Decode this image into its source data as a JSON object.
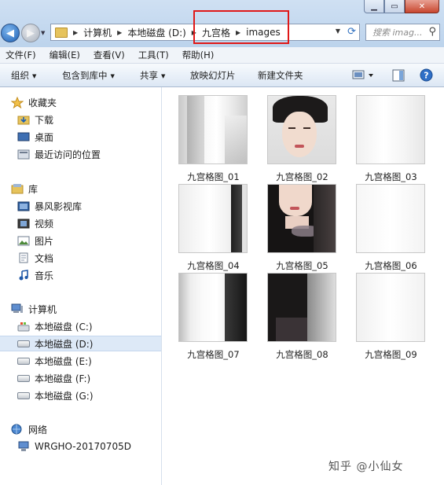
{
  "address": {
    "crumbs": [
      "计算机",
      "本地磁盘 (D:)",
      "九宫格",
      "images"
    ]
  },
  "search": {
    "placeholder": "搜索 imag..."
  },
  "menu": [
    "文件(F)",
    "编辑(E)",
    "查看(V)",
    "工具(T)",
    "帮助(H)"
  ],
  "toolbar": {
    "organize": "组织",
    "include": "包含到库中",
    "share": "共享",
    "slideshow": "放映幻灯片",
    "new_folder": "新建文件夹"
  },
  "sidebar": {
    "favorites": "收藏夹",
    "downloads": "下载",
    "desktop": "桌面",
    "recent": "最近访问的位置",
    "libraries": "库",
    "storm": "暴风影视库",
    "videos": "视频",
    "pictures": "图片",
    "documents": "文档",
    "music": "音乐",
    "computer": "计算机",
    "drive_c": "本地磁盘 (C:)",
    "drive_d": "本地磁盘 (D:)",
    "drive_e": "本地磁盘 (E:)",
    "drive_f": "本地磁盘 (F:)",
    "drive_g": "本地磁盘 (G:)",
    "network": "网络",
    "host": "WRGHO-20170705D"
  },
  "files": [
    "九宫格图_01",
    "九宫格图_02",
    "九宫格图_03",
    "九宫格图_04",
    "九宫格图_05",
    "九宫格图_06",
    "九宫格图_07",
    "九宫格图_08",
    "九宫格图_09"
  ],
  "watermark": "知乎 @小仙女",
  "colors": {
    "highlight": "#e01818",
    "selection": "#dde9f7",
    "toolbar": "#dce7f4"
  }
}
